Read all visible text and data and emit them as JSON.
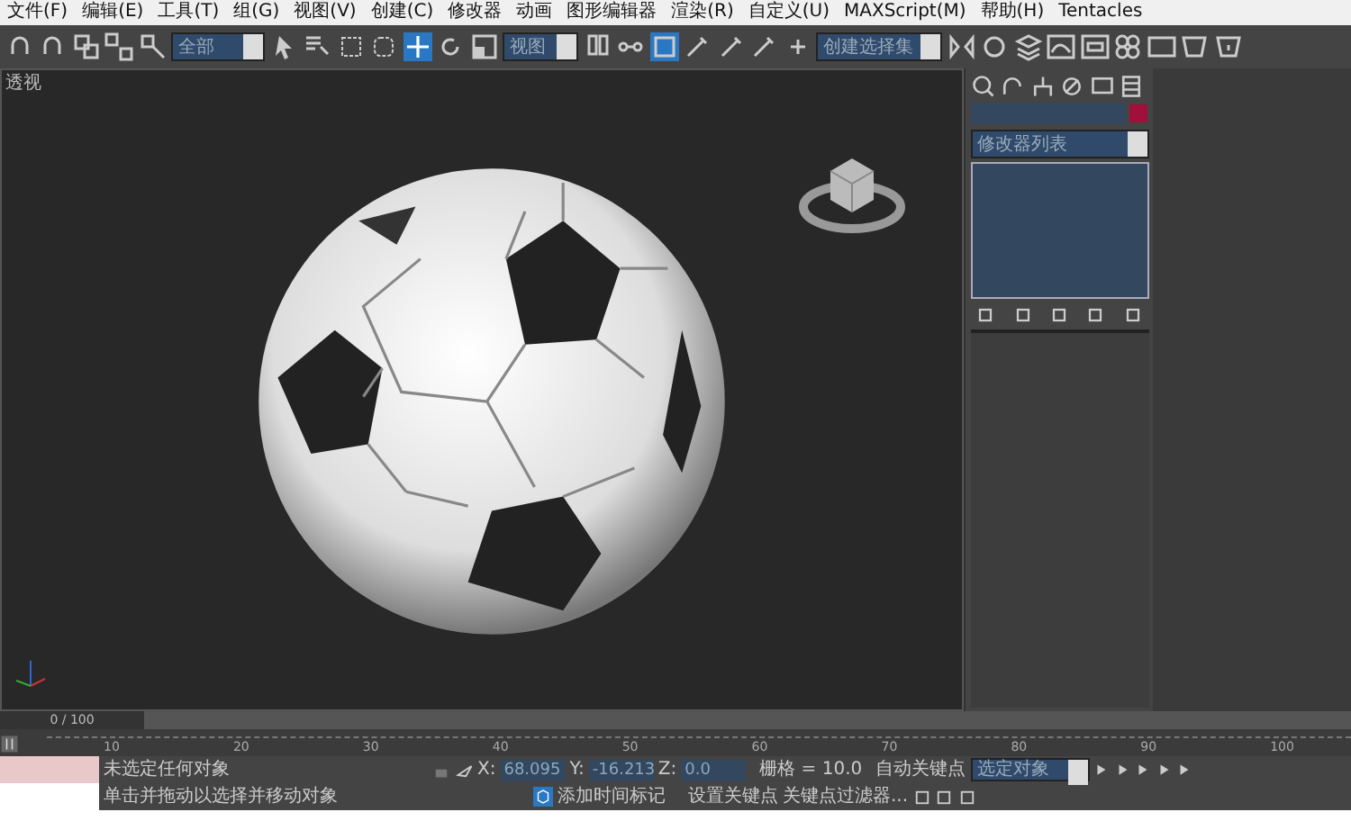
{
  "menu": [
    "文件(F)",
    "编辑(E)",
    "工具(T)",
    "组(G)",
    "视图(V)",
    "创建(C)",
    "修改器",
    "动画",
    "图形编辑器",
    "渲染(R)",
    "自定义(U)",
    "MAXScript(M)",
    "帮助(H)",
    "Tentacles"
  ],
  "toolbar": {
    "selection_filter": "全部",
    "reference_coord": "视图",
    "named_selection": "创建选择集"
  },
  "viewport": {
    "label": "透视"
  },
  "command_panel": {
    "modifier_list": "修改器列表"
  },
  "time_slider": {
    "label": "0 / 100",
    "level": 0
  },
  "track_ticks": [
    "10",
    "20",
    "30",
    "40",
    "50",
    "60",
    "70",
    "80",
    "90",
    "100"
  ],
  "status": {
    "coords": [
      {
        "label": "X:",
        "value": "68.095"
      },
      {
        "label": "Y:",
        "value": "-16.213"
      },
      {
        "label": "Z:",
        "value": "0.0"
      }
    ],
    "selection": "未选定任何对象",
    "prompt": "单击并拖动以选择并移动对象",
    "grid": "栅格 = 10.0",
    "add_time_tag": "添加时间标记",
    "auto_key": "自动关键点",
    "key_target": "选定对象",
    "set_key": "设置关键点",
    "key_filters": "关键点过滤器..."
  }
}
